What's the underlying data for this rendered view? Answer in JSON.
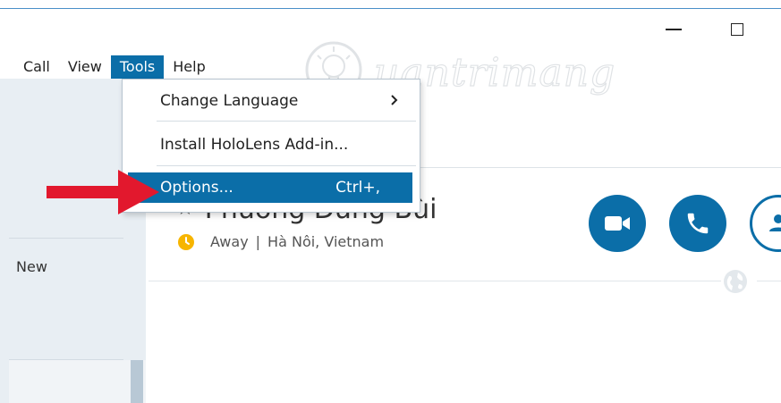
{
  "menubar": {
    "items": [
      {
        "label": "Call"
      },
      {
        "label": "View"
      },
      {
        "label": "Tools"
      },
      {
        "label": "Help"
      }
    ]
  },
  "tools_menu": {
    "change_language": "Change Language",
    "install_hololens": "Install HoloLens Add-in...",
    "options": "Options...",
    "options_shortcut": "Ctrl+,"
  },
  "sidebar": {
    "new_label": "New"
  },
  "contact": {
    "name": "Phương Dung Bùi",
    "status": "Away",
    "separator": "|",
    "location": "Hà Nôi, Vietnam"
  },
  "watermark": {
    "text": "uantrimang"
  },
  "icons": {
    "video_call": "video-camera-icon",
    "audio_call": "phone-icon",
    "add_contact": "add-person-icon",
    "status": "away-clock-icon",
    "globe": "globe-icon",
    "favorite": "star-icon",
    "submenu": "chevron-right-icon"
  },
  "colors": {
    "accent": "#0b6ea8",
    "away": "#f7b500",
    "arrow": "#e2182d"
  }
}
